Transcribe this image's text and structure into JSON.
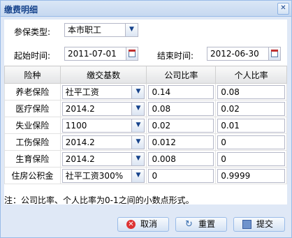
{
  "window": {
    "title": "缴费明细",
    "close_glyph": "✕"
  },
  "form": {
    "insured_type_label": "参保类型:",
    "insured_type_value": "本市职工",
    "start_label": "起始时间:",
    "start_value": "2011-07-01",
    "end_label": "结束时间:",
    "end_value": "2012-06-30"
  },
  "grid": {
    "headers": [
      "险种",
      "缴交基数",
      "公司比率",
      "个人比率"
    ],
    "rows": [
      {
        "type": "养老保险",
        "base": "社平工资",
        "company": "0.14",
        "personal": "0.08"
      },
      {
        "type": "医疗保险",
        "base": "2014.2",
        "company": "0.08",
        "personal": "0.02"
      },
      {
        "type": "失业保险",
        "base": "1100",
        "company": "0.02",
        "personal": "0.01"
      },
      {
        "type": "工伤保险",
        "base": "2014.2",
        "company": "0.012",
        "personal": "0"
      },
      {
        "type": "生育保险",
        "base": "2014.2",
        "company": "0.008",
        "personal": "0"
      },
      {
        "type": "住房公积金",
        "base": "社平工资300%",
        "company": "0",
        "personal": "0.9999"
      }
    ]
  },
  "note": "注：公司比率、个人比率为0-1之间的小数点形式。",
  "buttons": {
    "cancel": "取消",
    "reset": "重置",
    "submit": "提交"
  }
}
